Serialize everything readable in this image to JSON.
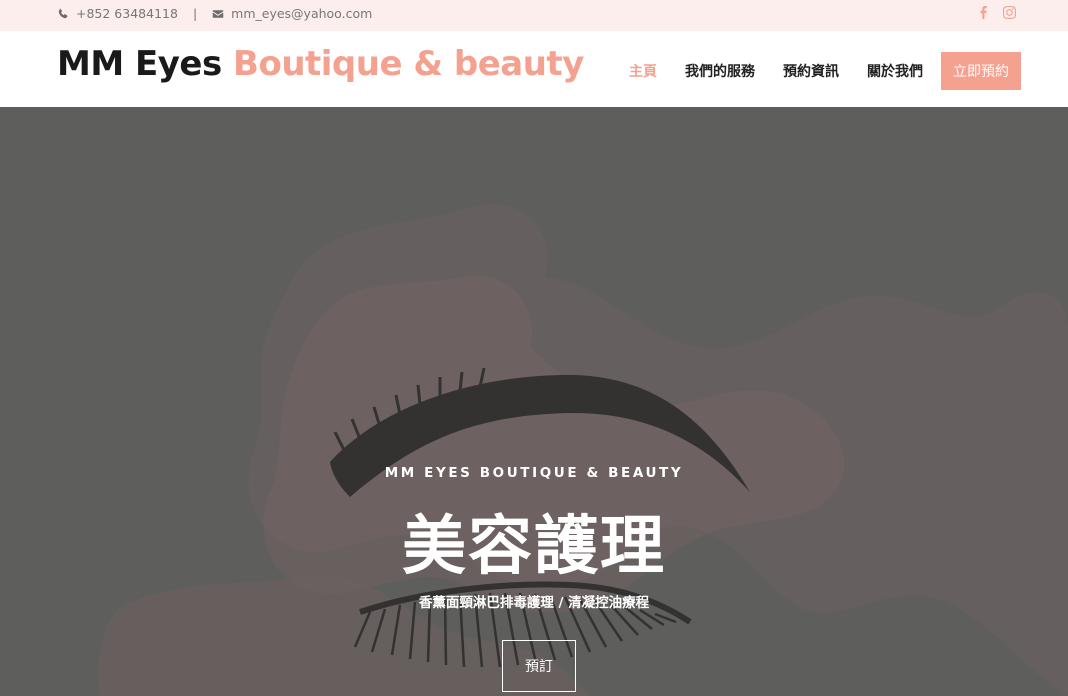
{
  "topbar": {
    "phone": "+852 63484118",
    "separator": "|",
    "email": "mm_eyes@yahoo.com",
    "icons": [
      "phone-icon",
      "mail-icon",
      "facebook-icon",
      "instagram-icon"
    ]
  },
  "header": {
    "logo_part1": "MM Eyes",
    "logo_part2": "Boutique & beauty",
    "nav": {
      "home": "主頁",
      "services": "我們的服務",
      "booking_info": "預約資訊",
      "about": "關於我們",
      "book_now": "立即預約"
    }
  },
  "hero": {
    "kicker": "MM EYES BOUTIQUE & BEAUTY",
    "headline": "美容護理",
    "subheadline": "香薰面頸淋巴排毒護理 / 清凝控油療程",
    "button": "預訂"
  },
  "colors": {
    "accent": "#f4a190",
    "topbar_bg": "#fdeeee",
    "hero_overlay": "#5f5e5d",
    "text_dark": "#1a1a1a"
  }
}
